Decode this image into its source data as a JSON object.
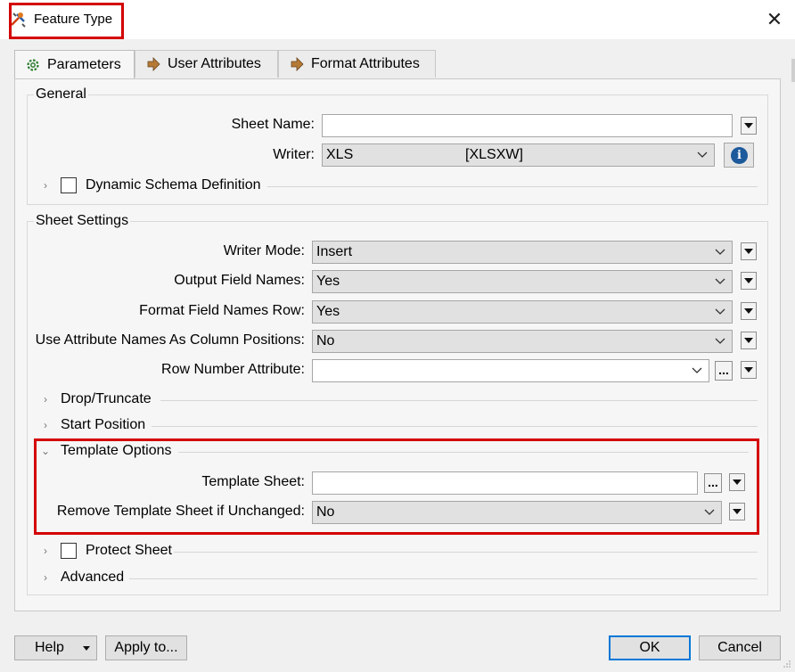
{
  "window": {
    "title": "Feature Type",
    "close_symbol": "✕"
  },
  "tabs": [
    {
      "label": "Parameters",
      "icon": "gear-icon",
      "active": true
    },
    {
      "label": "User Attributes",
      "icon": "arrow-right-icon",
      "active": false
    },
    {
      "label": "Format Attributes",
      "icon": "arrow-right-icon",
      "active": false
    }
  ],
  "general": {
    "title": "General",
    "sheet_name_label": "Sheet Name:",
    "sheet_name_value": "",
    "writer_label": "Writer:",
    "writer_value_left": "XLS",
    "writer_value_right": "[XLSXW]",
    "dynamic_schema_label": "Dynamic Schema Definition"
  },
  "sheet_settings": {
    "title": "Sheet Settings",
    "writer_mode_label": "Writer Mode:",
    "writer_mode_value": "Insert",
    "output_field_names_label": "Output Field Names:",
    "output_field_names_value": "Yes",
    "format_field_names_row_label": "Format Field Names Row:",
    "format_field_names_row_value": "Yes",
    "use_attr_names_label": "Use Attribute Names As Column Positions:",
    "use_attr_names_value": "No",
    "row_number_attr_label": "Row Number Attribute:",
    "row_number_attr_value": "",
    "dots_label": "...",
    "drop_truncate_label": "Drop/Truncate",
    "start_position_label": "Start Position",
    "template_options_label": "Template Options",
    "template_sheet_label": "Template Sheet:",
    "template_sheet_value": "",
    "remove_template_label": "Remove Template Sheet if Unchanged:",
    "remove_template_value": "No",
    "protect_sheet_label": "Protect Sheet",
    "advanced_label": "Advanced"
  },
  "footer": {
    "help_label": "Help",
    "apply_to_label": "Apply to...",
    "ok_label": "OK",
    "cancel_label": "Cancel"
  },
  "colors": {
    "highlight_red": "#d40000",
    "info_blue": "#1d5a9c",
    "ok_border": "#0078d7"
  }
}
